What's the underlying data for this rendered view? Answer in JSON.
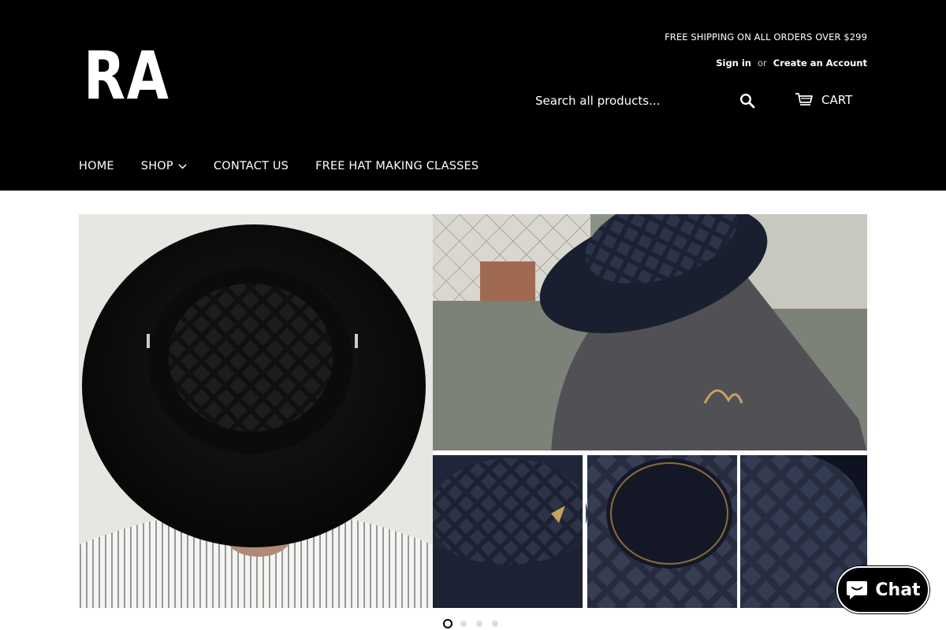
{
  "brand": {
    "logo_text": "RA"
  },
  "header": {
    "promo": "FREE SHIPPING ON ALL ORDERS OVER $299",
    "sign_in": "Sign in",
    "or": "or",
    "create_account": "Create an Account"
  },
  "search": {
    "placeholder": "Search all products...",
    "icon": "search-icon"
  },
  "cart": {
    "label": "CART",
    "icon": "cart-icon"
  },
  "nav": {
    "items": [
      {
        "label": "HOME"
      },
      {
        "label": "SHOP",
        "has_dropdown": true
      },
      {
        "label": "CONTACT US"
      },
      {
        "label": "FREE HAT MAKING CLASSES"
      }
    ]
  },
  "slideshow": {
    "active_slide": 1,
    "total_slides": 4
  },
  "chat": {
    "label": "Chat",
    "icon": "chat-bubble-icon"
  },
  "colors": {
    "header_bg": "#000000",
    "accent": "#000000",
    "dot_inactive": "#dddddd"
  }
}
